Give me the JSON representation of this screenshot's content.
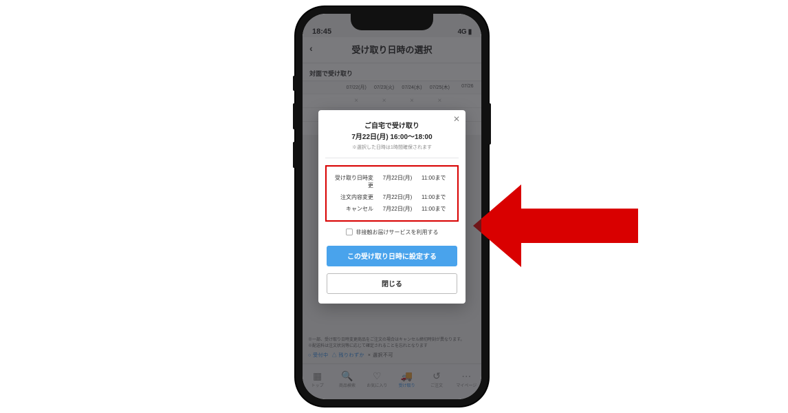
{
  "status": {
    "time": "18:45",
    "network": "4G"
  },
  "header": {
    "title": "受け取り日時の選択"
  },
  "section": {
    "label": "対面で受け取り"
  },
  "dates": {
    "cols": [
      "07/22(月)",
      "07/23(火)",
      "07/24(水)",
      "07/25(木)",
      "07/26"
    ]
  },
  "footer": {
    "note1": "※一部、受け取り日時変更商品をご注文の場合はキャンセル締切時刻が異なります。",
    "note2": "※配送料は注文状況等に応じて確定されることを忘れとなります",
    "legend_wait": "○ 受付中",
    "legend_few": "△ 残りわずか",
    "legend_na": "× 選択不可"
  },
  "tabs": {
    "t1": "トップ",
    "t2": "商品検索",
    "t3": "お気に入り",
    "t4": "受け取り",
    "t5": "ご注文",
    "t6": "マイページ"
  },
  "modal": {
    "title": "ご自宅で受け取り",
    "datetime": "7月22日(月) 16:00〜18:00",
    "note": "※選択した日時は1時間確保されます",
    "rows": [
      {
        "label": "受け取り日時変更",
        "date": "7月22日(月)",
        "time": "11:00まで"
      },
      {
        "label": "注文内容変更",
        "date": "7月22日(月)",
        "time": "11:00まで"
      },
      {
        "label": "キャンセル",
        "date": "7月22日(月)",
        "time": "11:00まで"
      }
    ],
    "checkbox_label": "非接触お届けサービスを利用する",
    "confirm": "この受け取り日時に設定する",
    "cancel": "閉じる"
  }
}
